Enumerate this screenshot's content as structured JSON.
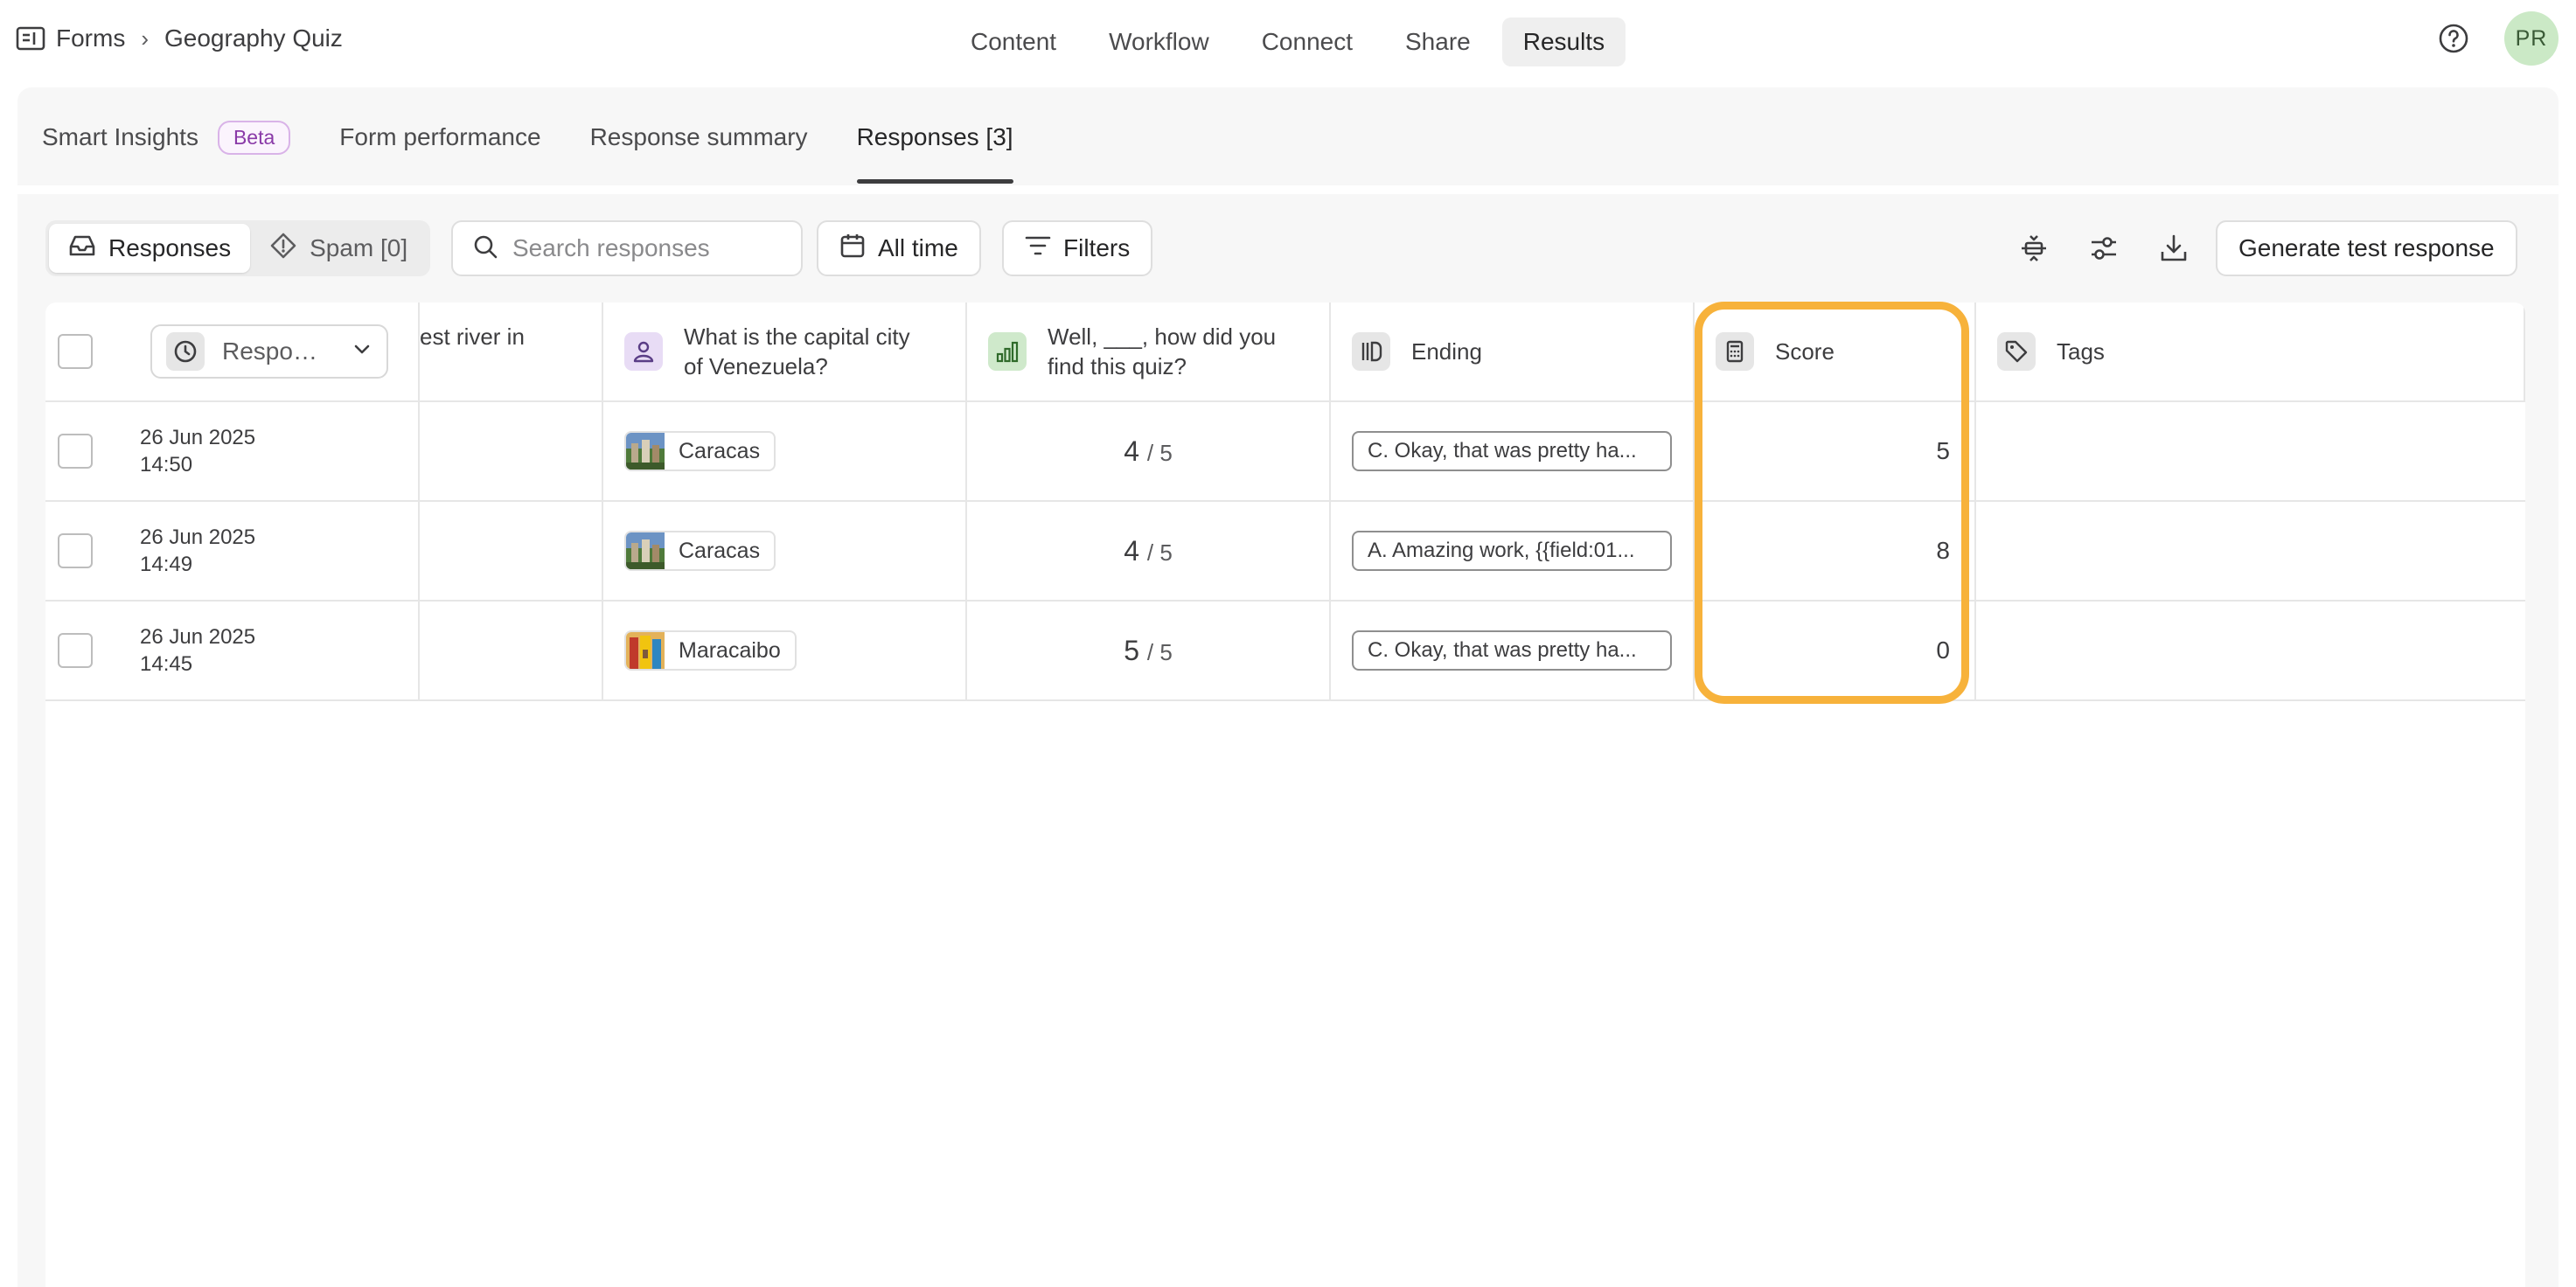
{
  "breadcrumb": {
    "root": "Forms",
    "current": "Geography Quiz",
    "separator": "›"
  },
  "topnav": [
    "Content",
    "Workflow",
    "Connect",
    "Share",
    "Results"
  ],
  "avatar": "PR",
  "subtabs": {
    "smart_insights": "Smart Insights",
    "beta": "Beta",
    "form_performance": "Form performance",
    "response_summary": "Response summary",
    "responses": "Responses [3]"
  },
  "toolbar": {
    "responses": "Responses",
    "spam": "Spam [0]",
    "search_placeholder": "Search responses",
    "all_time": "All time",
    "filters": "Filters",
    "generate": "Generate test response"
  },
  "table": {
    "headers": {
      "sort": "Respo…",
      "river": "est river in",
      "capital_line1": "What is the capital city",
      "capital_line2": "of Venezuela?",
      "quiz_line1": "Well, ___, how did you",
      "quiz_line2": "find this quiz?",
      "ending": "Ending",
      "score": "Score",
      "tags": "Tags"
    },
    "rows": [
      {
        "date": "26 Jun 2025",
        "time": "14:50",
        "city": "Caracas",
        "rating": "4",
        "rating_max": "/ 5",
        "ending": "C. Okay, that was pretty ha...",
        "score": "5"
      },
      {
        "date": "26 Jun 2025",
        "time": "14:49",
        "city": "Caracas",
        "rating": "4",
        "rating_max": "/ 5",
        "ending": "A. Amazing work, {{field:01...",
        "score": "8"
      },
      {
        "date": "26 Jun 2025",
        "time": "14:45",
        "city": "Maracaibo",
        "rating": "5",
        "rating_max": "/ 5",
        "ending": "C. Okay, that was pretty ha...",
        "score": "0"
      }
    ]
  },
  "colors": {
    "highlight": "#f7b23b",
    "active_tab_underline": "#3d3d3f",
    "avatar_bg": "#cbe9c6"
  }
}
